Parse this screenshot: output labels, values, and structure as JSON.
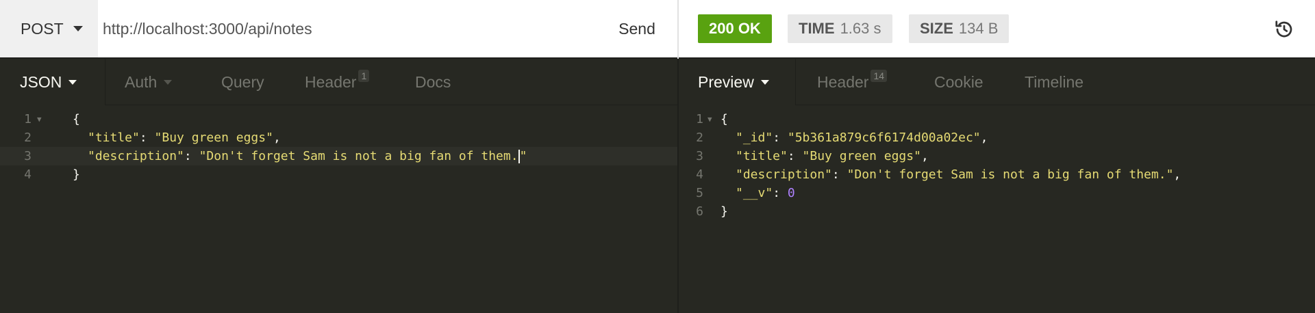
{
  "request": {
    "method": "POST",
    "url": "http://localhost:3000/api/notes",
    "send_label": "Send"
  },
  "response_meta": {
    "status": "200 OK",
    "time_key": "TIME",
    "time_value": "1.63 s",
    "size_key": "SIZE",
    "size_value": "134 B",
    "status_color": "#59a210"
  },
  "left_tabs": {
    "json": "JSON",
    "auth": "Auth",
    "query": "Query",
    "header": "Header",
    "header_count": "1",
    "docs": "Docs"
  },
  "right_tabs": {
    "preview": "Preview",
    "header": "Header",
    "header_count": "14",
    "cookie": "Cookie",
    "timeline": "Timeline"
  },
  "request_body": {
    "line_numbers": [
      "1",
      "2",
      "3",
      "4"
    ],
    "open_brace": "{",
    "title_key": "\"title\"",
    "title_value": "\"Buy green eggs\"",
    "description_key": "\"description\"",
    "description_value": "\"Don't forget Sam is not a big fan of them.",
    "description_close_quote": "\"",
    "close_brace": "}"
  },
  "response_body": {
    "line_numbers": [
      "1",
      "2",
      "3",
      "4",
      "5",
      "6"
    ],
    "open_brace": "{",
    "id_key": "\"_id\"",
    "id_value": "\"5b361a879c6f6174d00a02ec\"",
    "title_key": "\"title\"",
    "title_value": "\"Buy green eggs\"",
    "description_key": "\"description\"",
    "description_value": "\"Don't forget Sam is not a big fan of them.\"",
    "v_key": "\"__v\"",
    "v_value": "0",
    "close_brace": "}"
  },
  "icons": {
    "method_dropdown": "chevron-down-icon",
    "history": "history-icon"
  }
}
